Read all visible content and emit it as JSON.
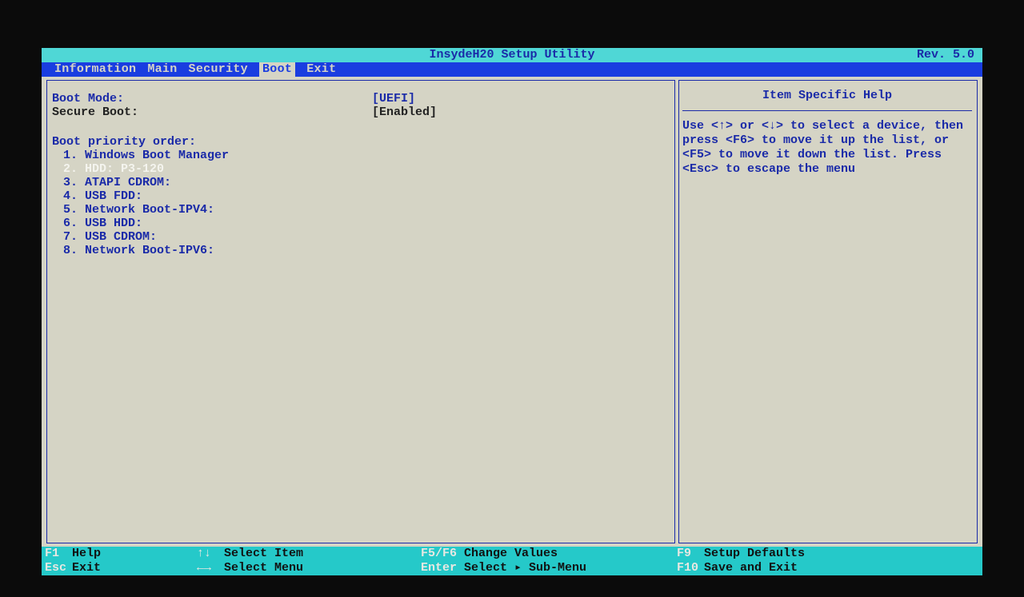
{
  "title": "InsydeH20 Setup Utility",
  "revision": "Rev. 5.0",
  "menubar": {
    "items": [
      "Information",
      "Main",
      "Security",
      "Boot",
      "Exit"
    ],
    "active": "Boot"
  },
  "main": {
    "boot_mode_label": "Boot Mode:",
    "boot_mode_value": "[UEFI]",
    "secure_boot_label": "Secure Boot:",
    "secure_boot_value": "[Enabled]",
    "order_title": "Boot priority order:",
    "boot_order": [
      "Windows Boot Manager",
      "HDD: P3-120",
      "ATAPI CDROM:",
      "USB FDD:",
      "Network Boot-IPV4:",
      "USB HDD:",
      "USB CDROM:",
      "Network Boot-IPV6:"
    ],
    "selected_index": 1
  },
  "help": {
    "title": "Item Specific Help",
    "text": "Use <↑> or <↓> to select a device, then press <F6> to move it up the list, or <F5> to move it down the list. Press <Esc> to escape the menu"
  },
  "footer": {
    "f1": "Help",
    "esc": "Exit",
    "updown": "Select Item",
    "leftright": "Select Menu",
    "f5f6": "Change Values",
    "enter": "Select ▸ Sub-Menu",
    "f9": "Setup Defaults",
    "f10": "Save and Exit"
  }
}
